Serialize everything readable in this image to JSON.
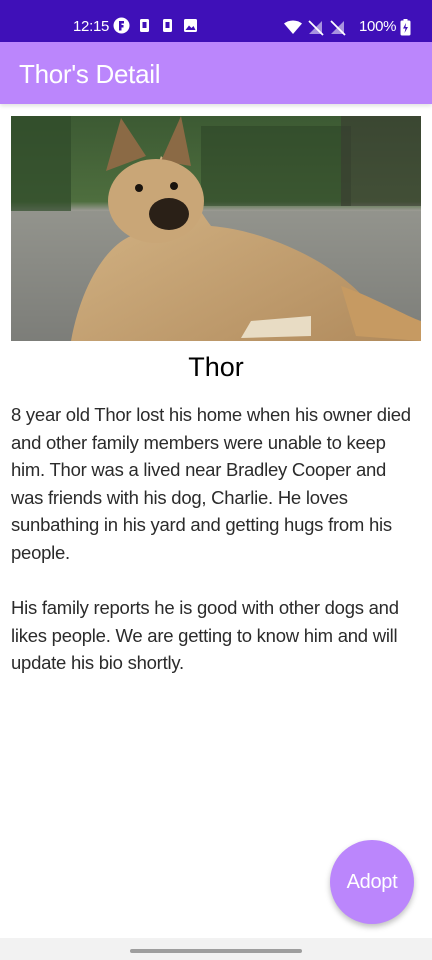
{
  "status_bar": {
    "time": "12:15",
    "battery_percent": "100%",
    "left_icons": [
      "notification-app-icon",
      "sim-icon",
      "sim-icon",
      "gallery-icon"
    ],
    "right_icons": [
      "wifi-icon",
      "no-signal-icon",
      "no-signal-icon",
      "battery-charging-icon"
    ],
    "background_color": "#3f10b8"
  },
  "app_bar": {
    "title": "Thor's Detail",
    "background_color": "#bb86fc"
  },
  "pet": {
    "name": "Thor",
    "photo": "german-shepherd-dog-photo",
    "bio_paragraphs": [
      "8 year old Thor lost his home when his owner died and other family members were unable to keep him. Thor was a lived near Bradley Cooper and was friends with his dog, Charlie. He loves sunbathing in his yard and getting hugs from his people.",
      "His family reports he is good with other dogs and likes people. We are getting to know him and will update his bio shortly."
    ]
  },
  "fab": {
    "label": "Adopt",
    "background_color": "#bb86fc"
  }
}
